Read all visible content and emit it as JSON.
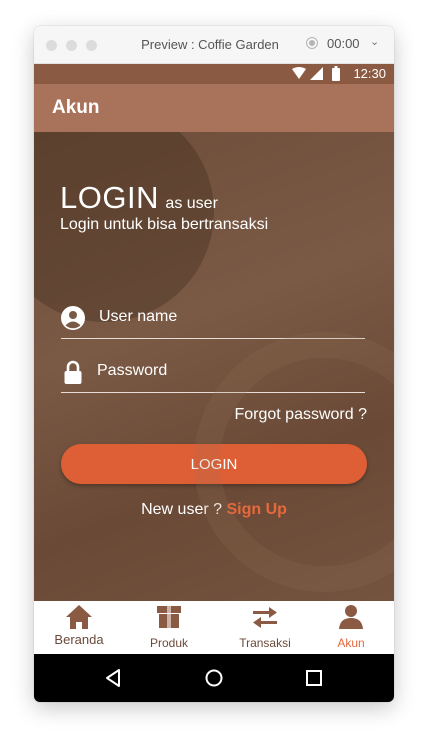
{
  "window": {
    "title": "Preview : Coffie Garden",
    "time": "00:00",
    "chevron": "⌄"
  },
  "status_bar": {
    "time": "12:30"
  },
  "app_bar": {
    "title": "Akun"
  },
  "login": {
    "heading": "LOGIN",
    "heading_suffix": "as user",
    "subtitle": "Login untuk bisa bertransaksi",
    "username_placeholder": "User name",
    "password_placeholder": "Password",
    "forgot": "Forgot password ?",
    "button": "LOGIN",
    "new_user": "New user ?",
    "sign_up": "Sign Up"
  },
  "bottom_nav": {
    "items": [
      {
        "label": "Beranda",
        "icon": "home-icon",
        "active": false
      },
      {
        "label": "Produk",
        "icon": "box-icon",
        "active": false
      },
      {
        "label": "Transaksi",
        "icon": "swap-arrows-icon",
        "active": false
      },
      {
        "label": "Akun",
        "icon": "person-icon",
        "active": true
      }
    ]
  },
  "colors": {
    "status_bar": "#8b5a43",
    "app_bar": "#a8735a",
    "accent": "#de5f36",
    "nav_icon": "#8b5a43",
    "nav_active": "#e6683d"
  }
}
